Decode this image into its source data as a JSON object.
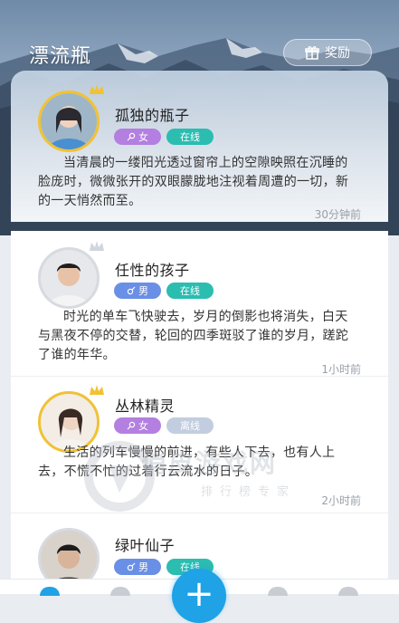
{
  "header": {
    "title": "漂流瓶",
    "reward_label": "奖励",
    "reward_icon": "gift-icon"
  },
  "posts": [
    {
      "name": "孤独的瓶子",
      "gender": "女",
      "gender_icon": "female-icon",
      "status": "在线",
      "vip": true,
      "text": "当清晨的一缕阳光透过窗帘上的空隙映照在沉睡的脸庞时，微微张开的双眼朦胧地注视着周遭的一切，新的一天悄然而至。",
      "time": "30分钟前"
    },
    {
      "name": "任性的孩子",
      "gender": "男",
      "gender_icon": "male-icon",
      "status": "在线",
      "vip": true,
      "text": "时光的单车飞快驶去，岁月的倒影也将消失，白天与黑夜不停的交替，轮回的四季斑驳了谁的岁月，蹉跎了谁的年华。",
      "time": "1小时前"
    },
    {
      "name": "丛林精灵",
      "gender": "女",
      "gender_icon": "female-icon",
      "status": "离线",
      "vip": true,
      "text": "生活的列车慢慢的前进，有些人下去，也有人上去，不慌不忙的过着行云流水的日子。",
      "time": "2小时前"
    },
    {
      "name": "绿叶仙子",
      "gender": "男",
      "gender_icon": "male-icon",
      "status": "在线",
      "vip": false
    }
  ],
  "fab": {
    "label": "+"
  },
  "watermark": {
    "text": "俏皮游戏网",
    "sub": "排行榜专家"
  },
  "colors": {
    "accent": "#1fa2e6",
    "female": "#b37fe0",
    "male": "#6a8fe6",
    "online": "#2bbdb0",
    "offline": "#c2cde0",
    "vip_ring": "#f1c232"
  }
}
